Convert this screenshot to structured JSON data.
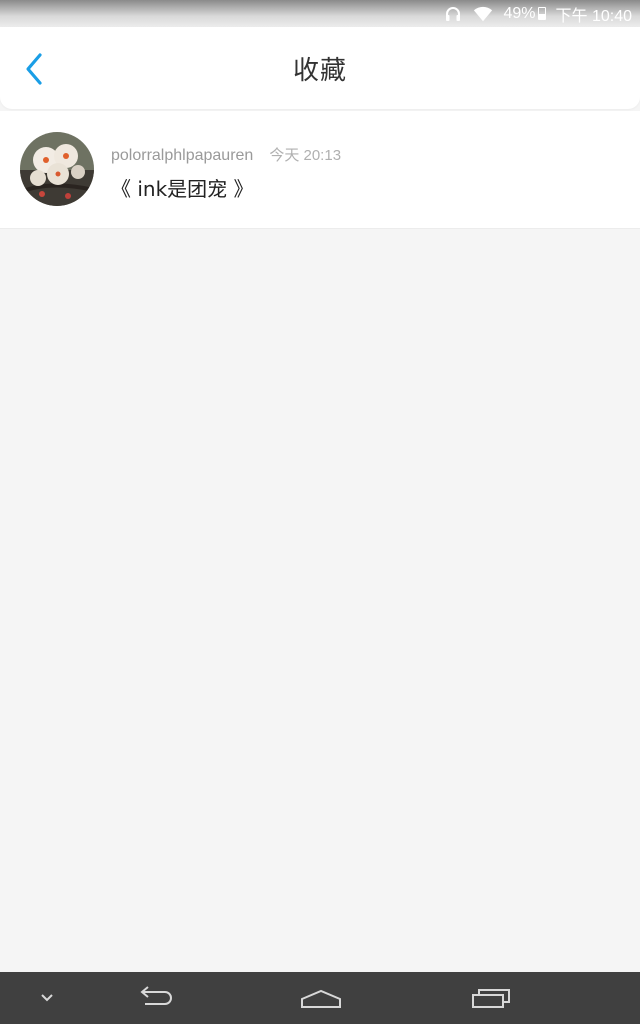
{
  "status_bar": {
    "battery_percent": "49%",
    "time": "下午 10:40",
    "icons": [
      "headphones-icon",
      "wifi-icon",
      "battery-icon"
    ]
  },
  "header": {
    "title": "收藏",
    "back_icon": "chevron-left-icon",
    "accent_color": "#1a9ee6"
  },
  "favorites": [
    {
      "user": "polorralphlpapauren",
      "time": "今天 20:13",
      "title": "《 ink是团宠 》",
      "avatar_icon": "plum-blossom-avatar"
    }
  ],
  "nav_bar": {
    "icons": [
      "hide-keyboard-icon",
      "back-icon",
      "home-icon",
      "recents-icon"
    ]
  }
}
